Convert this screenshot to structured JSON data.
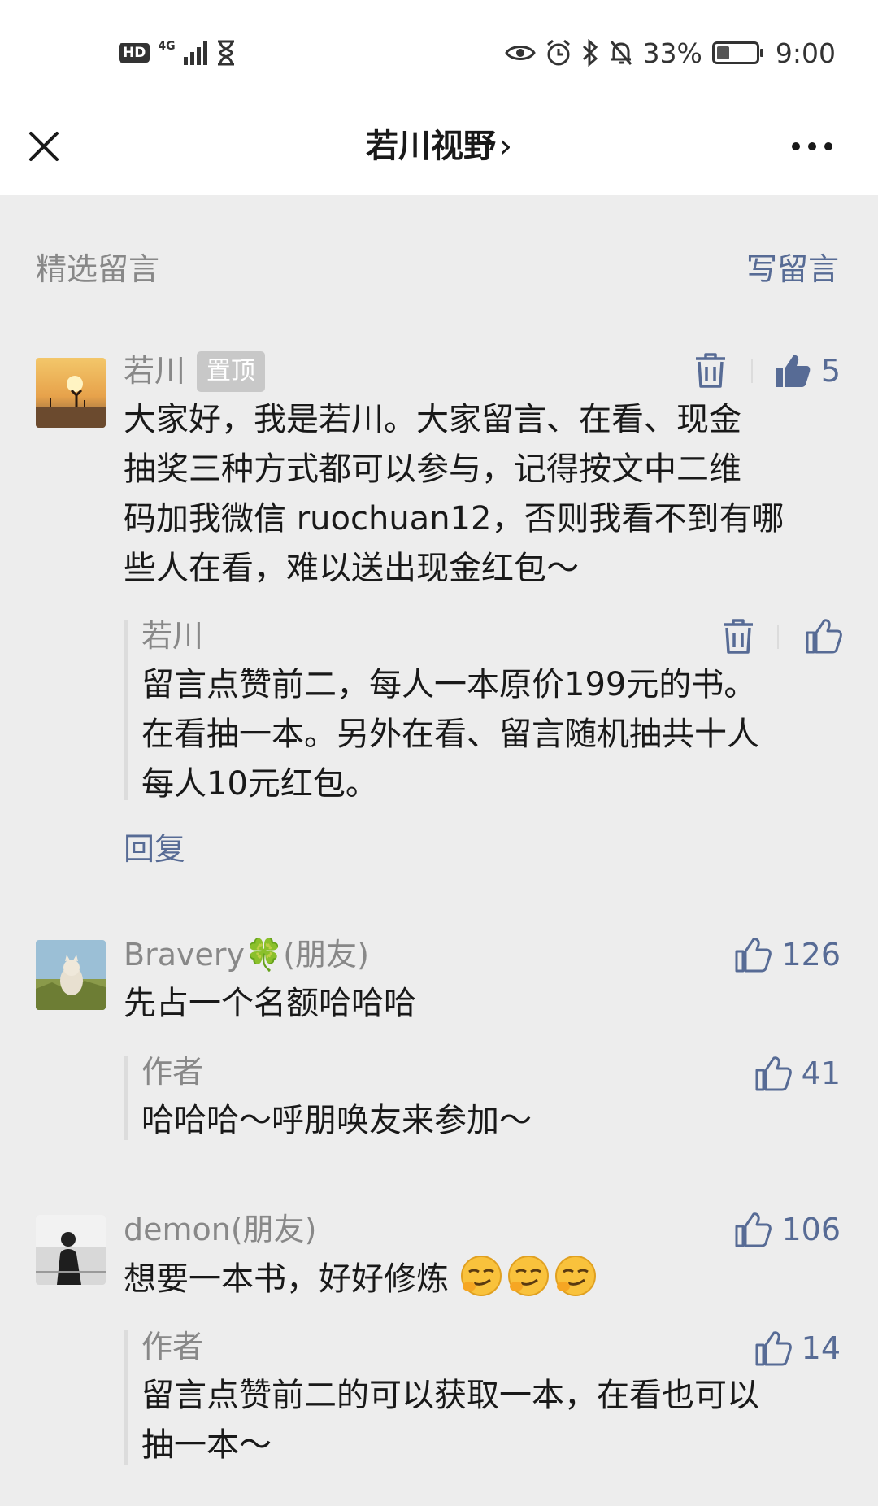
{
  "status_bar": {
    "hd": "HD",
    "network": "4G",
    "battery": "33%",
    "battery_level": 0.33,
    "time": "9:00"
  },
  "nav": {
    "title": "若川视野",
    "chevron": "›"
  },
  "section": {
    "title": "精选留言",
    "write_label": "写留言"
  },
  "comments": [
    {
      "nickname": "若川",
      "pinned_label": "置顶",
      "likes": "5",
      "liked": true,
      "lines": [
        "大家好，我是若川。大家留言、在看、现金",
        "抽奖三种方式都可以参与，记得按文中二维",
        "码加我微信 ruochuan12，否则我看不到有哪",
        "些人在看，难以送出现金红包～"
      ],
      "reply": {
        "author": "若川",
        "lines": [
          "留言点赞前二，每人一本原价199元的书。",
          "在看抽一本。另外在看、留言随机抽共十人",
          "每人10元红包。"
        ]
      },
      "reply_action": "回复"
    },
    {
      "nickname": "Bravery🍀(朋友)",
      "likes": "126",
      "lines": [
        "先占一个名额哈哈哈"
      ],
      "reply": {
        "author": "作者",
        "likes": "41",
        "lines": [
          "哈哈哈～呼朋唤友来参加～"
        ]
      }
    },
    {
      "nickname": "demon(朋友)",
      "likes": "106",
      "lines": [
        "想要一本书，好好修炼"
      ],
      "emoji_name": "smirk-emoji",
      "reply": {
        "author": "作者",
        "likes": "14",
        "lines": [
          "留言点赞前二的可以获取一本，在看也可以",
          "抽一本～"
        ]
      }
    }
  ],
  "colors": {
    "link": "#576b95",
    "meta": "#888888",
    "background": "#ededed"
  }
}
